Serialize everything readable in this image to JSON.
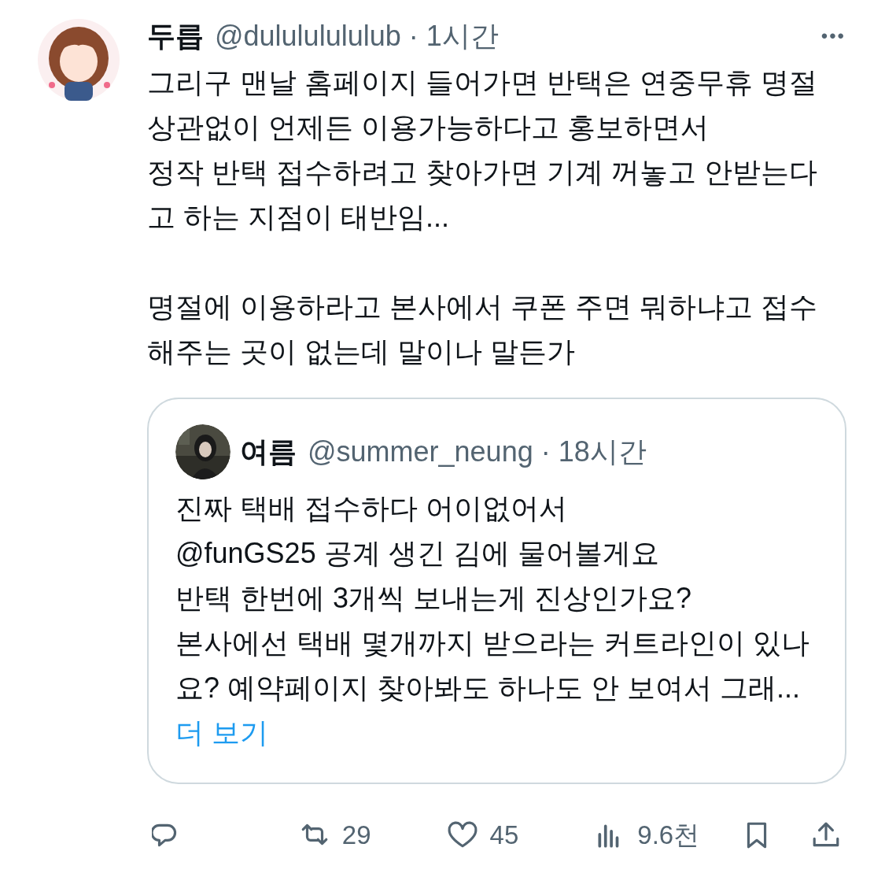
{
  "post": {
    "display_name": "두릅",
    "handle": "@dulululululub",
    "separator": "·",
    "time": "1시간",
    "more": "•••",
    "text": "그리구 맨날 홈페이지 들어가면 반택은 연중무휴 명절\n상관없이 언제든 이용가능하다고 홍보하면서\n정작 반택 접수하려고 찾아가면 기계 꺼놓고 안받는다\n고 하는 지점이 태반임...\n\n명절에 이용하라고 본사에서 쿠폰 주면 뭐하냐고 접수\n해주는 곳이 없는데 말이나 말든가"
  },
  "quote": {
    "display_name": "여름",
    "handle": "@summer_neung",
    "separator": "·",
    "time": "18시간",
    "text": "진짜 택배 접수하다 어이없어서\n@funGS25 공계 생긴 김에 물어볼게요\n반택 한번에 3개씩 보내는게 진상인가요?\n본사에선 택배 몇개까지 받으라는 커트라인이 있나\n요? 예약페이지 찾아봐도 하나도 안 보여서 그래...",
    "show_more": "더 보기"
  },
  "actions": [
    {
      "kind": "reply"
    },
    {
      "kind": "repost",
      "count": "29"
    },
    {
      "kind": "like",
      "count": "45"
    },
    {
      "kind": "views",
      "count": "9.6천"
    },
    {
      "kind": "bookmark"
    },
    {
      "kind": "share"
    }
  ]
}
